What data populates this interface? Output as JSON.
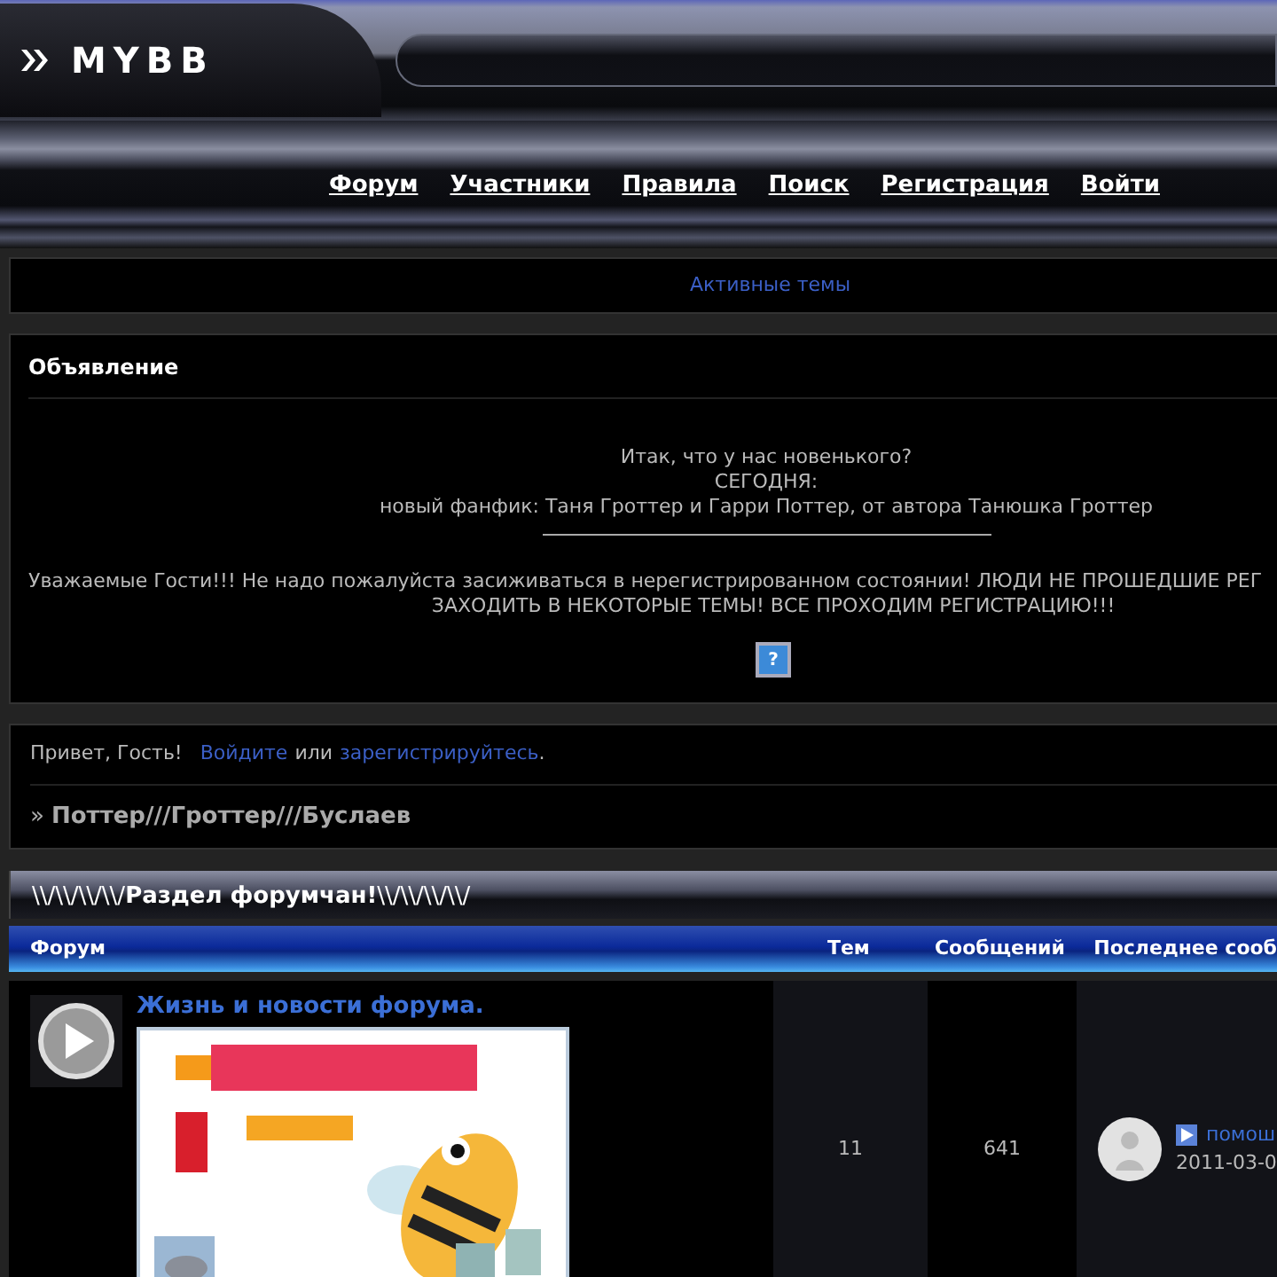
{
  "logo": "MYBB",
  "nav": [
    {
      "label": "Форум"
    },
    {
      "label": "Участники"
    },
    {
      "label": "Правила"
    },
    {
      "label": "Поиск"
    },
    {
      "label": "Регистрация"
    },
    {
      "label": "Войти"
    }
  ],
  "active_topics": "Активные темы",
  "announcement": {
    "title": "Объявление",
    "lines": [
      "Итак, что у нас новенького?",
      "СЕГОДНЯ:",
      "новый фанфик: Таня Гроттер и Гарри Поттер, от автора Танюшка Гроттер"
    ],
    "notice_lines": [
      "Уважаемые Гости!!! Не надо пожалуйста засиживаться в нерегистрированном состоянии! ЛЮДИ НЕ ПРОШЕДШИЕ РЕГ",
      "ЗАХОДИТЬ В НЕКОТОРЫЕ ТЕМЫ! ВСЕ ПРОХОДИМ РЕГИСТРАЦИЮ!!!"
    ],
    "help_icon": "?"
  },
  "welcome": {
    "greeting": "Привет, Гость!",
    "login_link": "Войдите",
    "or": "или",
    "register_link": "зарегистрируйтесь",
    "end": ".",
    "breadcrumb_prefix": "»",
    "breadcrumb": "Поттер///Гроттер///Буслаев"
  },
  "category": {
    "title": "\\\\/\\\\/\\\\/\\\\/**Раздел форумчан!**\\\\/\\\\/\\\\/\\\\/",
    "columns": [
      "Форум",
      "Тем",
      "Сообщений",
      "Последнее сооб"
    ],
    "rows": [
      {
        "name": "Жизнь и новости форума.",
        "topics": "11",
        "posts": "641",
        "last_post": {
          "link": "помош",
          "date": "2011-03-0"
        }
      }
    ]
  }
}
